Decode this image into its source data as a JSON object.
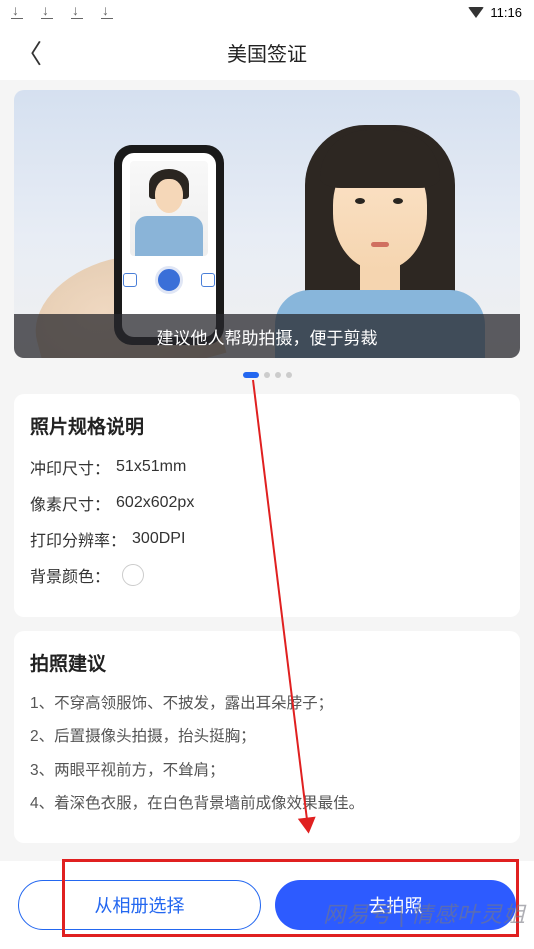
{
  "status": {
    "time": "11:16"
  },
  "nav": {
    "title": "美国签证"
  },
  "banner": {
    "caption": "建议他人帮助拍摄，便于剪裁"
  },
  "specs": {
    "title": "照片规格说明",
    "printSize": {
      "label": "冲印尺寸",
      "value": "51x51mm"
    },
    "pixelSize": {
      "label": "像素尺寸",
      "value": "602x602px"
    },
    "dpi": {
      "label": "打印分辨率",
      "value": "300DPI"
    },
    "bgColor": {
      "label": "背景颜色",
      "value": "#ffffff"
    }
  },
  "tips": {
    "title": "拍照建议",
    "items": [
      "1、不穿高领服饰、不披发，露出耳朵脖子；",
      "2、后置摄像头拍摄，抬头挺胸；",
      "3、两眼平视前方，不耸肩；",
      "4、着深色衣服，在白色背景墙前成像效果最佳。"
    ]
  },
  "actions": {
    "album": "从相册选择",
    "camera": "去拍照"
  },
  "watermark": {
    "brand": "网易号",
    "author": "情感叶灵姐"
  }
}
